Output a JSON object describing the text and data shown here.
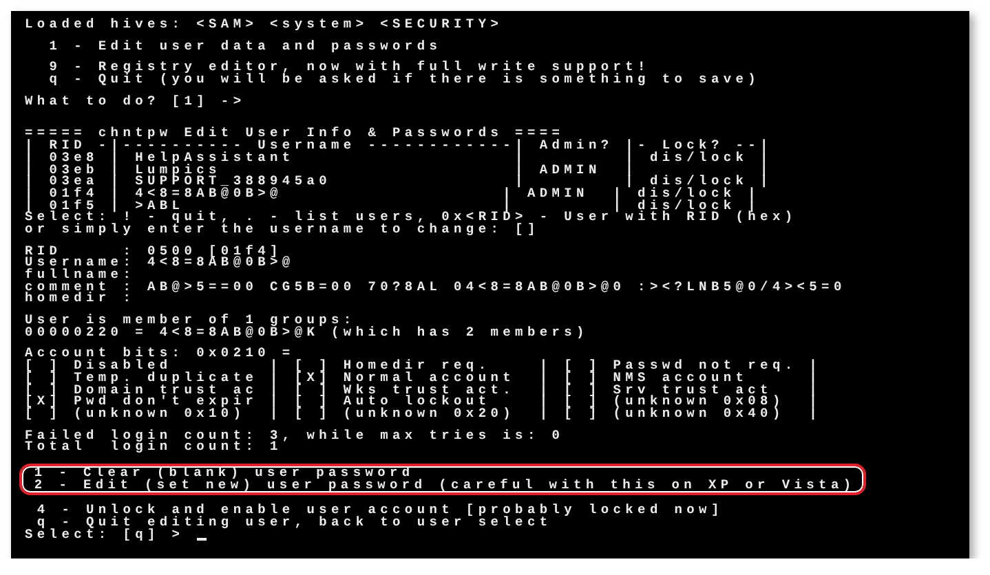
{
  "terminal": {
    "blocks": [
      {
        "highlighted": false,
        "lines": [
          "Loaded hives: <SAM> <system> <SECURITY>"
        ]
      },
      {
        "highlighted": false,
        "lines": [
          "  1 - Edit user data and passwords"
        ]
      },
      {
        "highlighted": false,
        "lines": [
          "  9 - Registry editor, now with full write support!",
          "  q - Quit (you will be asked if there is something to save)"
        ]
      },
      {
        "highlighted": false,
        "lines": [
          "What to do? [1] ->"
        ]
      },
      {
        "highlighted": false,
        "lines": [
          "===== chntpw Edit User Info & Passwords ====",
          "| RID -|---------- Username ------------| Admin? |- Lock? --|",
          "| 03e8 | HelpAssistant                  |        | dis/lock |",
          "| 03eb | Lumpics                        | ADMIN  |          |",
          "| 03ea | SUPPORT_388945a0               |        | dis/lock |",
          "| 01f4 | 4<8=8AB@0B>@                  | ADMIN  | dis/lock |",
          "| 01f5 | >ABL                          |        | dis/lock |",
          "Select: ! - quit, . - list users, 0x<RID> - User with RID (hex)",
          "or simply enter the username to change: []"
        ]
      },
      {
        "highlighted": false,
        "lines": [
          "RID     : 0500 [01f4]",
          "Username: 4<8=8AB@0B>@",
          "fullname:",
          "comment : AB@>5==00 CG5B=00 70?8AL 04<8=8AB@0B>@0 :><?LNB5@0/4><5=0",
          "homedir :"
        ]
      },
      {
        "highlighted": false,
        "lines": [
          "User is member of 1 groups:",
          "00000220 = 4<8=8AB@0B>@K (which has 2 members)"
        ]
      },
      {
        "highlighted": false,
        "lines": [
          "Account bits: 0x0210 =",
          "[ ] Disabled        | [ ] Homedir req.    | [ ] Passwd not req. |",
          "[ ] Temp. duplicate | [X] Normal account  | [ ] NMS account     |",
          "[ ] Domain trust ac | [ ] Wks trust act.  | [ ] Srv trust act   |",
          "[X] Pwd don't expir | [ ] Auto lockout    | [ ] (unknown 0x08)  |",
          "[ ] (unknown 0x10)  | [ ] (unknown 0x20)  | [ ] (unknown 0x40)  |"
        ]
      },
      {
        "highlighted": false,
        "lines": [
          "Failed login count: 3, while max tries is: 0",
          "Total  login count: 1"
        ]
      },
      {
        "highlighted": true,
        "lines": [
          " 1 - Clear (blank) user password",
          " 2 - Edit (set new) user password (careful with this on XP or Vista)"
        ]
      },
      {
        "highlighted": false,
        "cursor": true,
        "lines": [
          " 4 - Unlock and enable user account [probably locked now]",
          " q - Quit editing user, back to user select",
          "Select: [q] >"
        ]
      }
    ]
  }
}
